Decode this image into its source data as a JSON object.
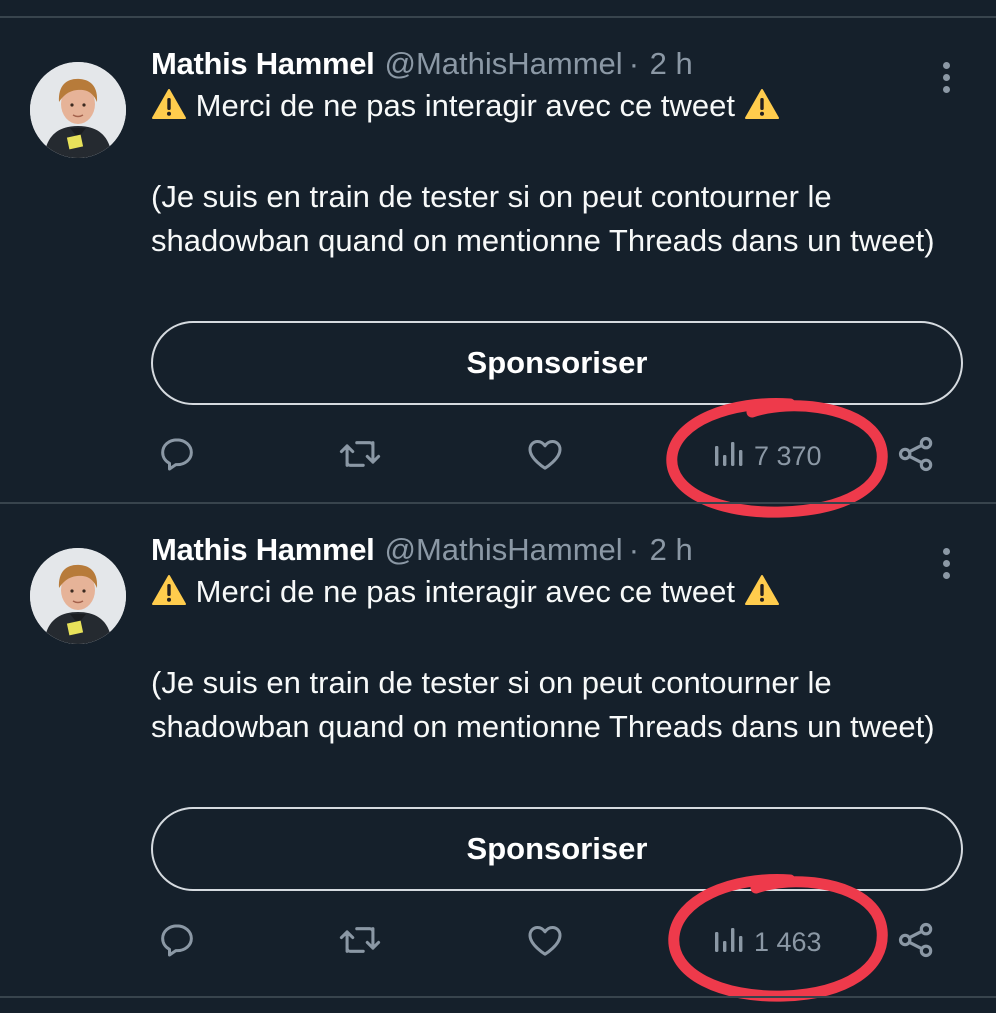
{
  "colors": {
    "background": "#15202b",
    "divider": "#38444d",
    "secondary_text": "#8b98a5",
    "annotation": "#ee3a4b",
    "warning": "#ffcc4d"
  },
  "tweets": [
    {
      "author_name": "Mathis Hammel",
      "handle": "@MathisHammel",
      "separator": "·",
      "time": "2 h",
      "text_line1": "Merci de ne pas interagir avec ce tweet",
      "text_para2": "(Je suis en train de tester si on peut contourner le shadowban quand on mentionne Threads dans un tweet)",
      "promote_label": "Sponsoriser",
      "views": "7 370",
      "icons": [
        "warning-icon",
        "reply-icon",
        "retweet-icon",
        "like-icon",
        "views-icon",
        "share-icon",
        "more-icon"
      ]
    },
    {
      "author_name": "Mathis Hammel",
      "handle": "@MathisHammel",
      "separator": "·",
      "time": "2 h",
      "text_line1": "Merci de ne pas interagir avec ce tweet",
      "text_para2": "(Je suis en train de tester si on peut contourner le shadowban quand on mentionne Threads dans un tweet)",
      "promote_label": "Sponsoriser",
      "views": "1 463",
      "icons": [
        "warning-icon",
        "reply-icon",
        "retweet-icon",
        "like-icon",
        "views-icon",
        "share-icon",
        "more-icon"
      ]
    }
  ]
}
